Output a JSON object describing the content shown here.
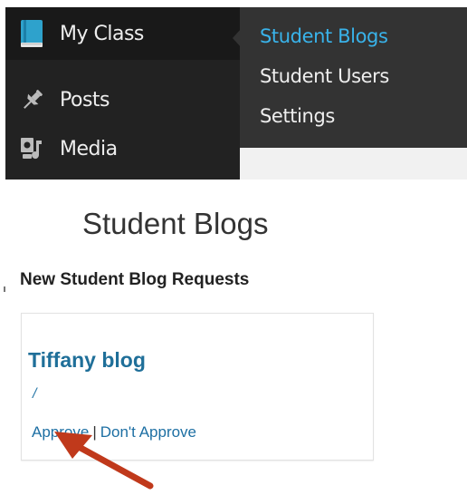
{
  "sidebar": {
    "items": [
      {
        "label": "My Class",
        "icon": "book-icon"
      },
      {
        "label": "Posts",
        "icon": "pushpin-icon"
      },
      {
        "label": "Media",
        "icon": "media-icon"
      }
    ]
  },
  "submenu": {
    "items": [
      {
        "label": "Student Blogs",
        "active": true
      },
      {
        "label": "Student Users"
      },
      {
        "label": "Settings"
      }
    ]
  },
  "page": {
    "title": "Student Blogs",
    "section_heading": "New Student Blog Requests"
  },
  "request": {
    "blog_title": "Tiffany blog",
    "path": "/",
    "approve_label": "Approve",
    "separator": "|",
    "dont_approve_label": "Don't Approve"
  },
  "colors": {
    "menu_bg": "#222222",
    "submenu_bg": "#333333",
    "accent": "#39b3ea",
    "link": "#1d6fa3",
    "arrow": "#c0391b"
  }
}
